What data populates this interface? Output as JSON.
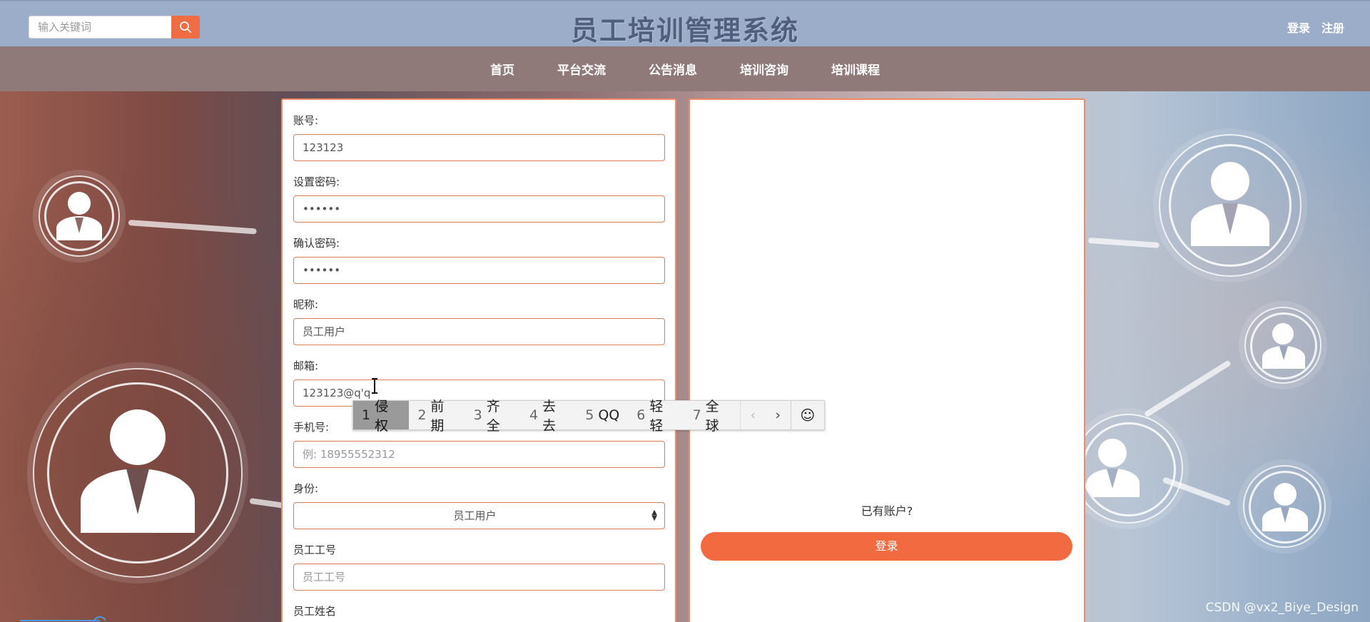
{
  "header": {
    "search_placeholder": "输入关键词",
    "title": "员工培训管理系统",
    "login_link": "登录",
    "register_link": "注册"
  },
  "nav": {
    "items": [
      {
        "label": "首页"
      },
      {
        "label": "平台交流"
      },
      {
        "label": "公告消息"
      },
      {
        "label": "培训咨询"
      },
      {
        "label": "培训课程"
      }
    ]
  },
  "form": {
    "account_label": "账号:",
    "account_value": "123123",
    "password_label": "设置密码:",
    "password_value": "••••••",
    "confirm_label": "确认密码:",
    "confirm_value": "••••••",
    "nickname_label": "昵称:",
    "nickname_value": "员工用户",
    "email_label": "邮箱:",
    "email_value": "123123@q'q",
    "phone_label": "手机号:",
    "phone_placeholder": "例: 18955552312",
    "role_label": "身份:",
    "role_value": "员工用户",
    "employee_no_label": "员工工号",
    "employee_no_placeholder": "员工工号",
    "employee_name_label": "员工姓名"
  },
  "side": {
    "have_account": "已有账户?",
    "login_button": "登录"
  },
  "ime": {
    "candidates": [
      {
        "num": "1",
        "text": "侵权"
      },
      {
        "num": "2",
        "text": "前期"
      },
      {
        "num": "3",
        "text": "齐全"
      },
      {
        "num": "4",
        "text": "去去"
      },
      {
        "num": "5",
        "text": "QQ"
      },
      {
        "num": "6",
        "text": "轻轻"
      },
      {
        "num": "7",
        "text": "全球"
      }
    ],
    "prev": "‹",
    "next": "›",
    "emoji": "☺"
  },
  "watermark": "CSDN @vx2_Biye_Design",
  "colors": {
    "header_bg": "#9badc9",
    "nav_bg": "#907a79",
    "accent": "#f26a40",
    "title_color": "#4f5f7d"
  }
}
